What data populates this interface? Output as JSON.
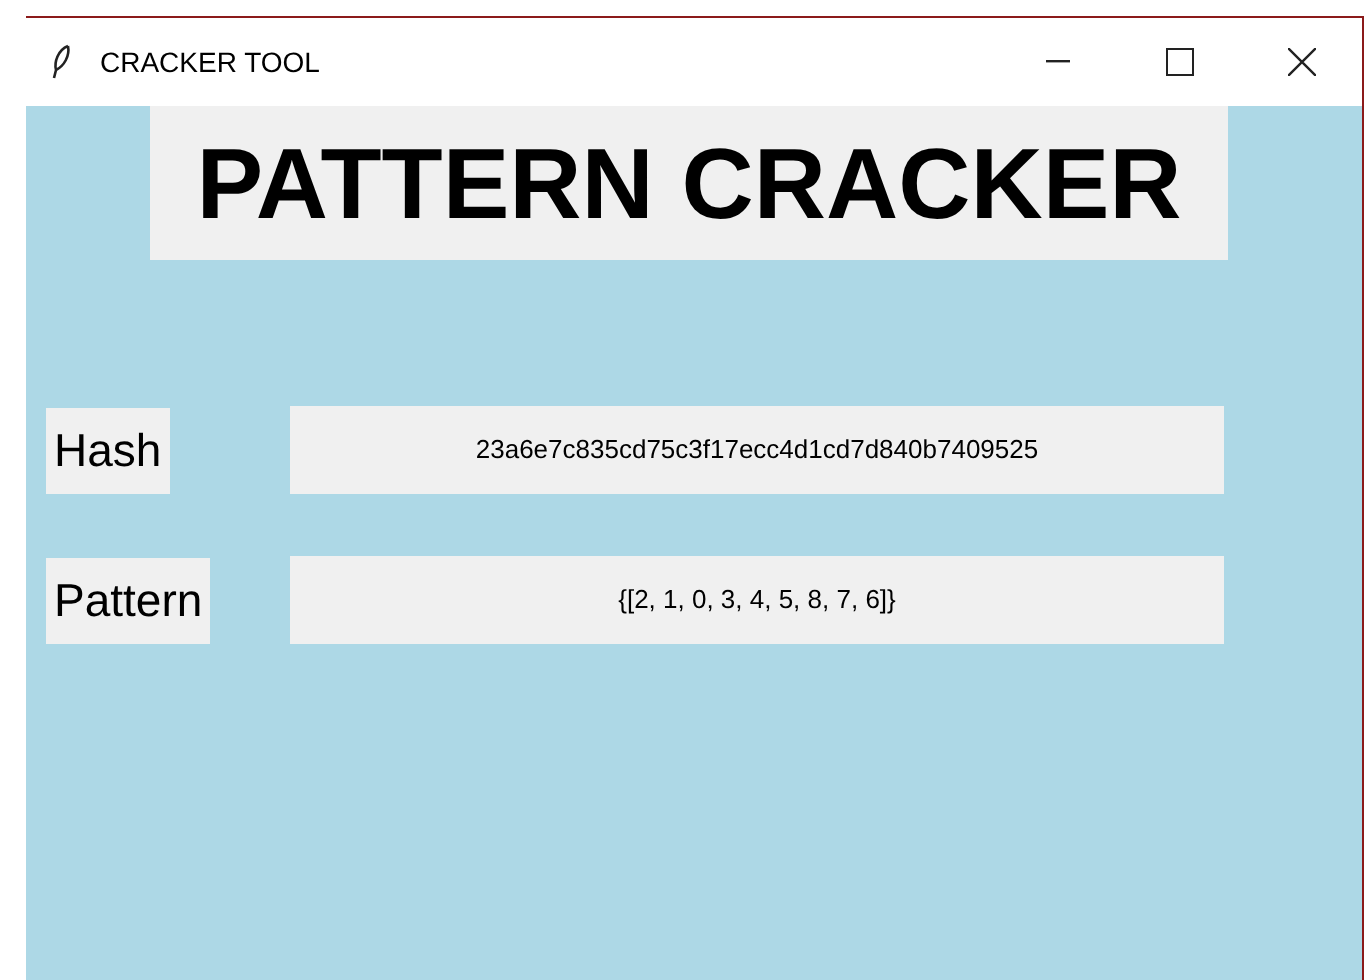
{
  "window": {
    "title": "CRACKER TOOL"
  },
  "heading": "PATTERN CRACKER",
  "fields": [
    {
      "label": "Hash",
      "value": "23a6e7c835cd75c3f17ecc4d1cd7d840b7409525"
    },
    {
      "label": "Pattern",
      "value": "{[2, 1, 0, 3, 4, 5, 8, 7, 6]}"
    }
  ]
}
